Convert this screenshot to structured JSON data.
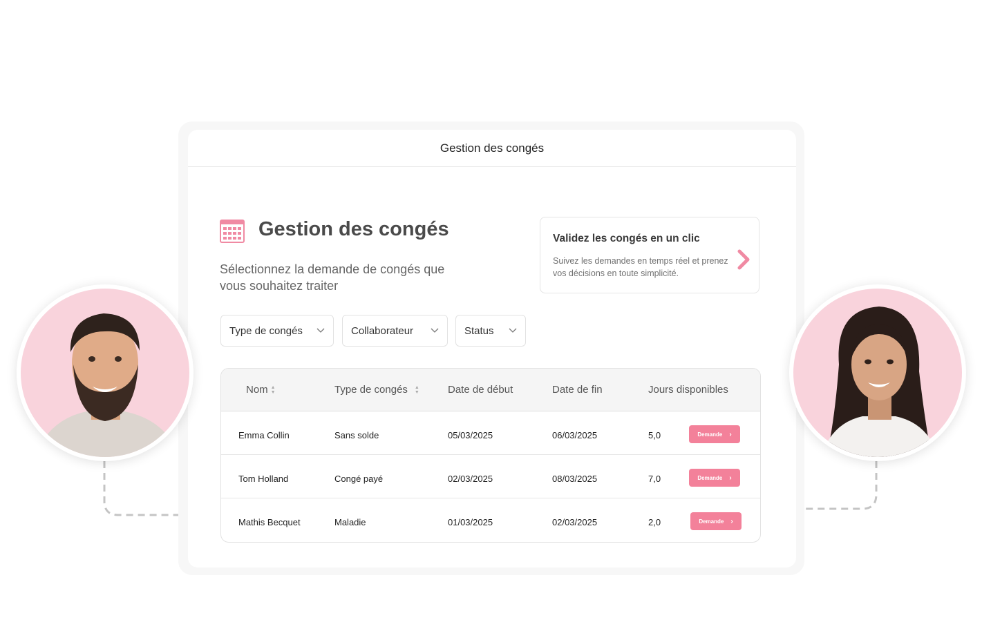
{
  "window": {
    "title": "Gestion des congés"
  },
  "header": {
    "title": "Gestion des congés",
    "subtitle": "Sélectionnez la demande de congés que vous souhaitez traiter",
    "icon": "calendar-icon"
  },
  "promo": {
    "title": "Validez les congés en un clic",
    "text": "Suivez les demandes en temps réel et prenez vos décisions en toute simplicité.",
    "icon": "chevron-right-icon"
  },
  "filters": [
    {
      "label": "Type de congés"
    },
    {
      "label": "Collaborateur"
    },
    {
      "label": "Status"
    }
  ],
  "table": {
    "columns": [
      "Nom",
      "Type de congés",
      "Date de début",
      "Date de fin",
      "Jours disponibles"
    ],
    "rows": [
      {
        "name": "Emma Collin",
        "type": "Sans solde",
        "start": "05/03/2025",
        "end": "06/03/2025",
        "days": "5,0",
        "action": "Demande"
      },
      {
        "name": "Tom Holland",
        "type": "Congé payé",
        "start": "02/03/2025",
        "end": "08/03/2025",
        "days": "7,0",
        "action": "Demande"
      },
      {
        "name": "Mathis Becquet",
        "type": "Maladie",
        "start": "01/03/2025",
        "end": "02/03/2025",
        "days": "2,0",
        "action": "Demande"
      }
    ]
  },
  "colors": {
    "accent": "#f3819a",
    "avatar_bg": "#f9d3dc",
    "connector": "#c4c4c4"
  }
}
